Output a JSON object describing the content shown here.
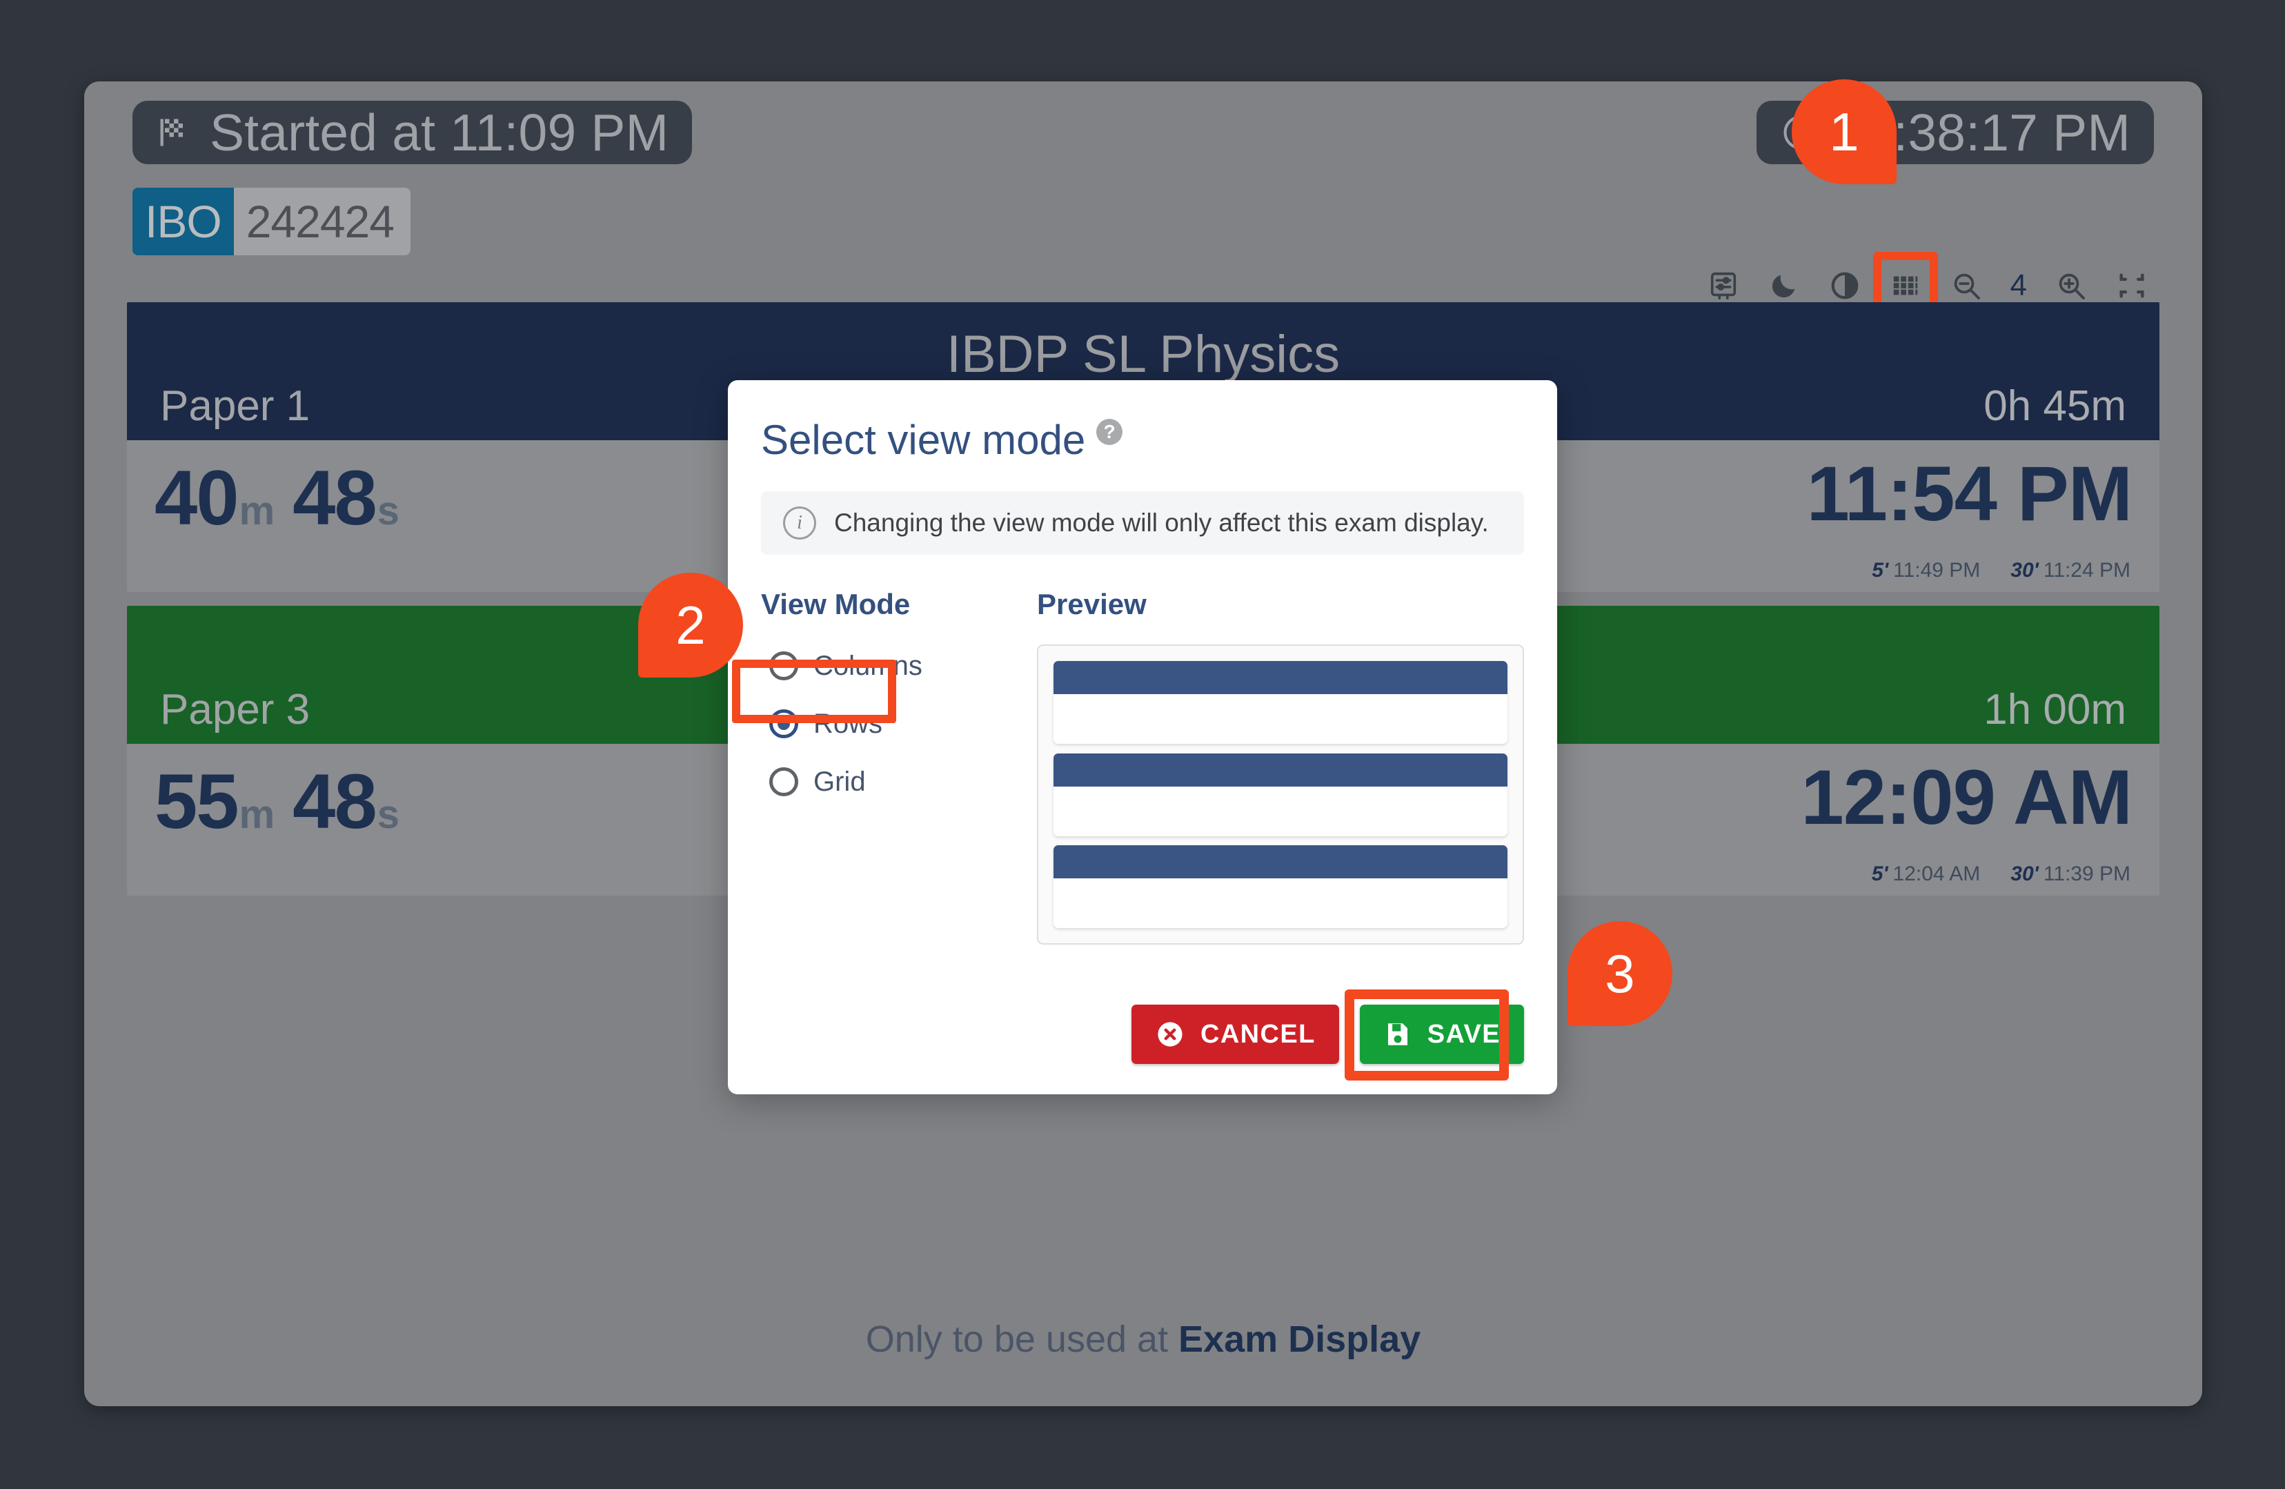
{
  "display": {
    "started_label": "Started at 11:09 PM",
    "clock_time": "11:38:17 PM",
    "code_prefix": "IBO",
    "code_number": "242424",
    "zoom_level": "4",
    "footer_prefix": "Only to be used at ",
    "footer_strong": "Exam Display",
    "icons": [
      "display-settings-icon",
      "moon-icon",
      "contrast-icon",
      "grid-icon",
      "zoom-out-icon",
      "zoom-in-icon",
      "compress-icon"
    ]
  },
  "exams": [
    {
      "title": "IBDP SL Physics",
      "paper": "Paper 1",
      "duration": "0h 45m",
      "remaining_minutes": "40",
      "remaining_minutes_unit": "m",
      "remaining_seconds": "48",
      "remaining_seconds_unit": "s",
      "end_time": "11:54 PM",
      "warn_5_label": "5'",
      "warn_5_time": "11:49 PM",
      "warn_30_label": "30'",
      "warn_30_time": "11:24 PM",
      "accent": "#1b2947"
    },
    {
      "title": "",
      "paper": "Paper 3",
      "duration": "1h 00m",
      "remaining_minutes": "55",
      "remaining_minutes_unit": "m",
      "remaining_seconds": "48",
      "remaining_seconds_unit": "s",
      "end_time": "12:09 AM",
      "warn_5_label": "5'",
      "warn_5_time": "12:04 AM",
      "warn_30_label": "30'",
      "warn_30_time": "11:39 PM",
      "accent": "#186227"
    }
  ],
  "modal": {
    "title": "Select view mode",
    "help_icon_glyph": "?",
    "info_icon_glyph": "i",
    "info_text": "Changing the view mode will only affect this exam display.",
    "view_mode_heading": "View Mode",
    "preview_heading": "Preview",
    "options": [
      {
        "label": "Columns",
        "checked": false
      },
      {
        "label": "Rows",
        "checked": true
      },
      {
        "label": "Grid",
        "checked": false
      }
    ],
    "selected_option": "Rows",
    "preview_rows": 3,
    "cancel_label": "CANCEL",
    "save_label": "SAVE"
  },
  "steps": [
    {
      "number": "1",
      "target": "grid-view-icon"
    },
    {
      "number": "2",
      "target": "rows-radio-option"
    },
    {
      "number": "3",
      "target": "save-button"
    }
  ],
  "colors": {
    "accent_orange": "#f4481f",
    "blue_header": "#1b2947",
    "green_header": "#186227",
    "save_green": "#14a038",
    "cancel_red": "#ce2127",
    "brand_blue": "#0f5f87"
  }
}
